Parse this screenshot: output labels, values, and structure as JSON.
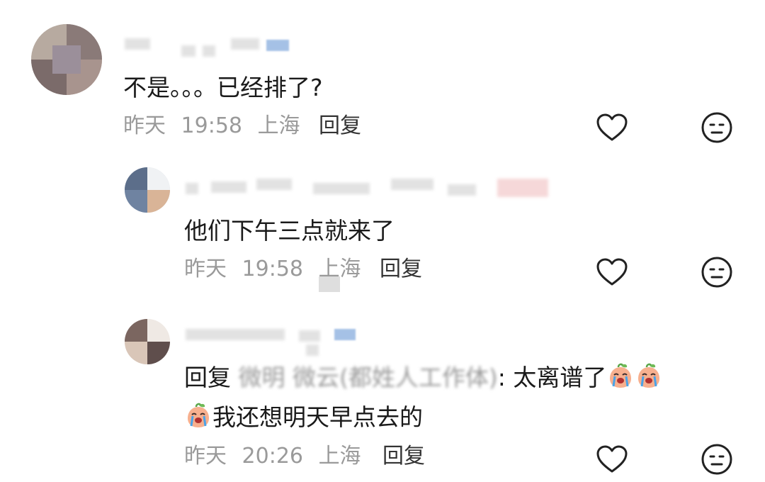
{
  "comments": [
    {
      "text": "不是。。。已经排了?",
      "date": "昨天",
      "time": "19:58",
      "location": "上海",
      "reply_label": "回复"
    },
    {
      "text": "他们下午三点就来了",
      "date": "昨天",
      "time": "19:58",
      "location": "上海",
      "reply_label": "回复"
    },
    {
      "reply_prefix": "回复",
      "reply_to_name": "微明 微云(都姓人工作体)",
      "text_line1": ": 太离谱了",
      "text_line2": "我还想明天早点去的",
      "date": "昨天",
      "time": "20:26",
      "location": "上海",
      "reply_label": "回复"
    }
  ],
  "icons": {
    "like": "heart-outline-icon",
    "dislike": "meh-face-icon",
    "emoji": "crying-peach-emoji"
  },
  "colors": {
    "meta_gray": "#9a9a9a",
    "text": "#1a1a1a"
  }
}
